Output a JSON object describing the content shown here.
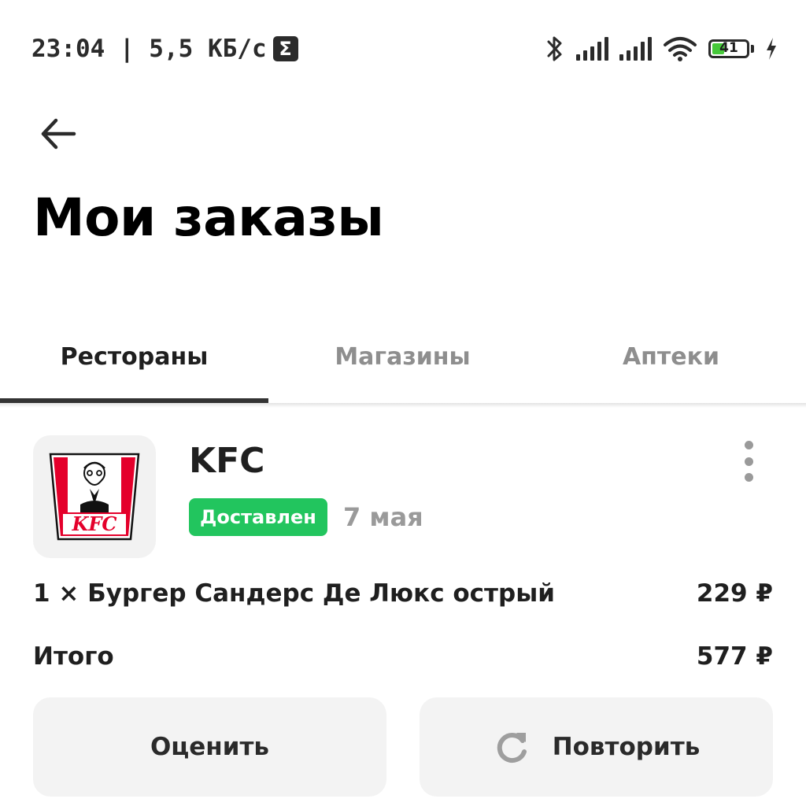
{
  "status_bar": {
    "time_speed": "23:04 | 5,5 КБ/с",
    "sigma_glyph": "Σ",
    "battery_level": "41",
    "battery_fraction": 0.41,
    "icons": [
      "bluetooth-icon",
      "signal-icon",
      "signal-icon",
      "wifi-icon",
      "battery-icon",
      "charging-icon"
    ]
  },
  "header": {
    "back_icon": "back-arrow-icon",
    "title": "Мои заказы"
  },
  "tabs": [
    {
      "label": "Рестораны",
      "active": true
    },
    {
      "label": "Магазины",
      "active": false
    },
    {
      "label": "Аптеки",
      "active": false
    }
  ],
  "order": {
    "restaurant": "KFC",
    "logo_text": "KFC",
    "status": "Доставлен",
    "date": "7 мая",
    "item": {
      "text": "1 × Бургер Сандерс Де Люкс острый",
      "price": "229 ₽"
    },
    "total": {
      "label": "Итого",
      "value": "577 ₽"
    },
    "actions": {
      "rate_label": "Оценить",
      "repeat_label": "Повторить"
    }
  },
  "colors": {
    "status_green": "#22c55e",
    "kfc_red": "#e4002b",
    "battery_green": "#46c83a"
  }
}
